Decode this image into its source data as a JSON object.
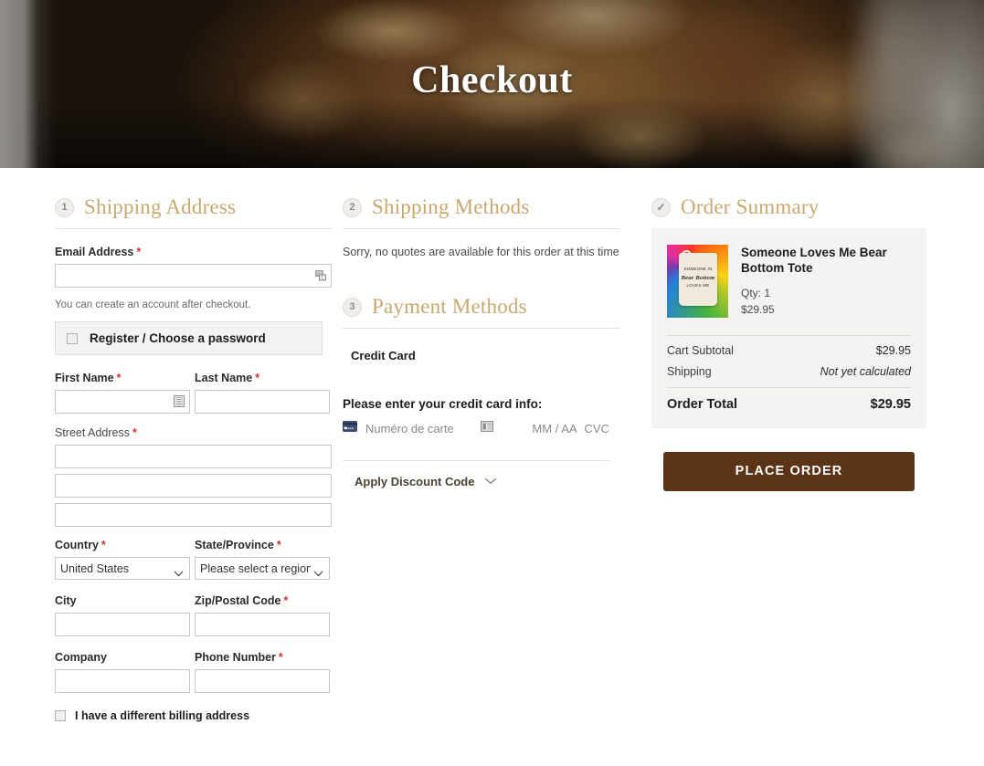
{
  "hero": {
    "title": "Checkout",
    "image_alt": "roast-turkey-on-slate-board"
  },
  "shipping_address": {
    "step": "1",
    "heading": "Shipping Address",
    "email": {
      "label": "Email Address",
      "required": "*",
      "value": "",
      "placeholder": "",
      "helper": "You can create an account after checkout."
    },
    "register": {
      "label": "Register / Choose a password",
      "checked": false
    },
    "first_name": {
      "label": "First Name",
      "required": "*",
      "value": "",
      "placeholder": ""
    },
    "last_name": {
      "label": "Last Name",
      "required": "*",
      "value": "",
      "placeholder": ""
    },
    "street": {
      "label": "Street Address",
      "required": "*",
      "line1": "",
      "line2": "",
      "line3": "",
      "placeholder": ""
    },
    "country": {
      "label": "Country",
      "required": "*",
      "selected": "United States"
    },
    "state": {
      "label": "State/Province",
      "required": "*",
      "selected": "Please select a region, s"
    },
    "city": {
      "label": "City",
      "required": "",
      "value": "",
      "placeholder": ""
    },
    "zip": {
      "label": "Zip/Postal Code",
      "required": "*",
      "value": "",
      "placeholder": ""
    },
    "company": {
      "label": "Company",
      "required": "",
      "value": "",
      "placeholder": ""
    },
    "phone": {
      "label": "Phone Number",
      "required": "*",
      "value": "",
      "placeholder": ""
    },
    "different_billing": {
      "label": "I have a different billing address",
      "checked": false
    }
  },
  "shipping_methods": {
    "step": "2",
    "heading": "Shipping Methods",
    "message": "Sorry, no quotes are available for this order at this time"
  },
  "payment_methods": {
    "step": "3",
    "heading": "Payment Methods",
    "option_label": "Credit Card",
    "cc_prompt": "Please enter your credit card info:",
    "card_number_placeholder": "Numéro de carte",
    "expiry_placeholder": "MM / AA",
    "cvc_placeholder": "CVC",
    "discount_label": "Apply Discount Code"
  },
  "order_summary": {
    "step_mark": "✓",
    "heading": "Order Summary",
    "product": {
      "name": "Someone Loves Me Bear Bottom Tote",
      "qty_label": "Qty: 1",
      "price": "$29.95",
      "thumb_line1": "SOMEONE IN",
      "thumb_line2": "Bear Bottom",
      "thumb_line3": "LOVES ME"
    },
    "lines": [
      {
        "label": "Cart Subtotal",
        "value": "$29.95",
        "italic": false
      },
      {
        "label": "Shipping",
        "value": "Not yet calculated",
        "italic": true
      }
    ],
    "total": {
      "label": "Order Total",
      "value": "$29.95"
    },
    "place_order_label": "PLACE ORDER"
  },
  "colors": {
    "heading_gold": "#c9a870",
    "place_order_brown": "#5b3317",
    "required_red": "#d0342c",
    "panel_gray": "#f4f3f1"
  }
}
